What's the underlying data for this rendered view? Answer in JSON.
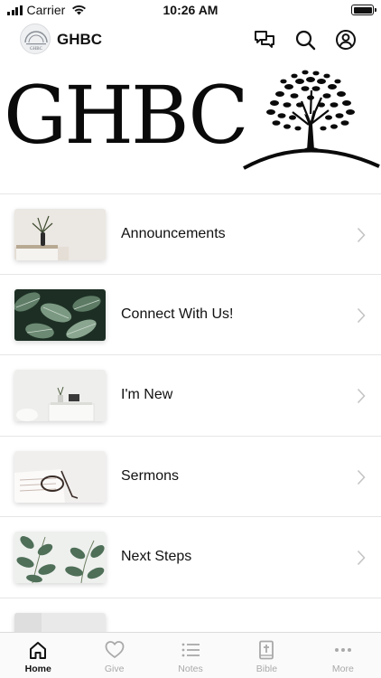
{
  "status_bar": {
    "carrier": "Carrier",
    "time": "10:26 AM",
    "battery_level": 1.0
  },
  "header": {
    "title": "GHBC",
    "logo_text": "GHBC",
    "icons": [
      "chat-icon",
      "search-icon",
      "profile-icon"
    ]
  },
  "banner": {
    "title": "GHBC"
  },
  "list": {
    "items": [
      {
        "label": "Announcements",
        "thumb": "vase-on-shelf"
      },
      {
        "label": "Connect With Us!",
        "thumb": "green-leaves"
      },
      {
        "label": "I'm New",
        "thumb": "desk-chair-room"
      },
      {
        "label": "Sermons",
        "thumb": "glasses-on-book"
      },
      {
        "label": "Next Steps",
        "thumb": "eucalyptus-plant"
      },
      {
        "label": "",
        "thumb": "partial-item"
      }
    ]
  },
  "tab_bar": {
    "tabs": [
      {
        "label": "Home",
        "icon": "home-icon",
        "active": true
      },
      {
        "label": "Give",
        "icon": "heart-icon",
        "active": false
      },
      {
        "label": "Notes",
        "icon": "list-icon",
        "active": false
      },
      {
        "label": "Bible",
        "icon": "bible-icon",
        "active": false
      },
      {
        "label": "More",
        "icon": "more-icon",
        "active": false
      }
    ]
  },
  "colors": {
    "accent": "#111111",
    "inactive": "#a9a9a9",
    "divider": "#e6e6e6"
  }
}
